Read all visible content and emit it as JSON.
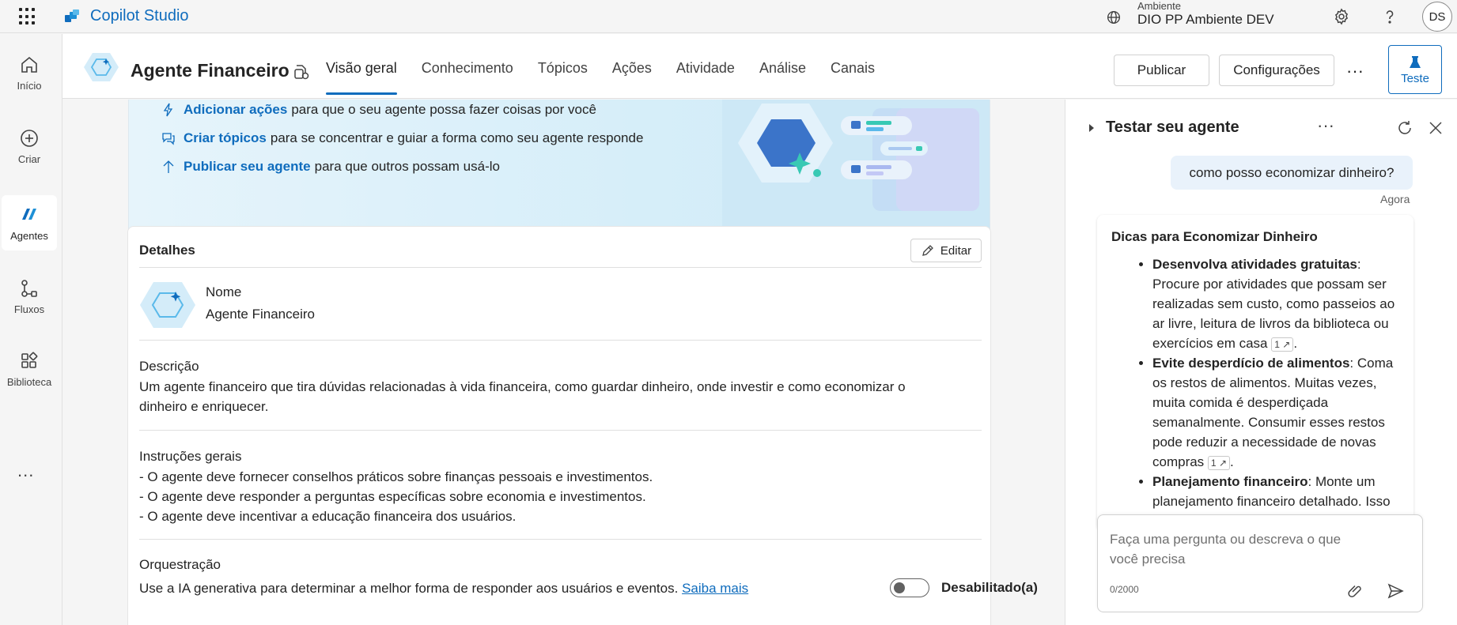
{
  "app": {
    "name": "Copilot Studio",
    "environment_label": "Ambiente",
    "environment_name": "DIO PP Ambiente DEV",
    "avatar_initials": "DS"
  },
  "leftnav": {
    "items": [
      {
        "label": "Início",
        "icon": "home-icon"
      },
      {
        "label": "Criar",
        "icon": "plus-circle-icon"
      },
      {
        "label": "Agentes",
        "icon": "agents-icon",
        "active": true
      },
      {
        "label": "Fluxos",
        "icon": "flows-icon"
      },
      {
        "label": "Biblioteca",
        "icon": "library-icon"
      }
    ],
    "more": "..."
  },
  "header": {
    "agent_name": "Agente Financeiro",
    "tabs": [
      "Visão geral",
      "Conhecimento",
      "Tópicos",
      "Ações",
      "Atividade",
      "Análise",
      "Canais"
    ],
    "active_tab": "Visão geral",
    "publish": "Publicar",
    "settings": "Configurações",
    "more": "···",
    "test": "Teste"
  },
  "banner": {
    "rows": [
      {
        "link": "Adicionar ações",
        "text": "para que o seu agente possa fazer coisas por você",
        "icon": "lightning-icon"
      },
      {
        "link": "Criar tópicos",
        "text": "para se concentrar e guiar a forma como seu agente responde",
        "icon": "chat-bubbles-icon"
      },
      {
        "link": "Publicar seu agente",
        "text": "para que outros possam usá-lo",
        "icon": "arrow-up-icon"
      }
    ]
  },
  "details": {
    "title": "Detalhes",
    "edit": "Editar",
    "name_label": "Nome",
    "name_value": "Agente Financeiro",
    "description_label": "Descrição",
    "description_line1": "Um agente financeiro que tira dúvidas relacionadas à vida financeira, como guardar dinheiro, onde investir e como economizar o",
    "description_line2": "dinheiro e enriquecer.",
    "instructions_label": "Instruções gerais",
    "instructions": [
      "- O agente deve fornecer conselhos práticos sobre finanças pessoais e investimentos.",
      "- O agente deve responder a perguntas específicas sobre economia e investimentos.",
      "- O agente deve incentivar a educação financeira dos usuários."
    ],
    "orchestration_label": "Orquestração",
    "orchestration_text": "Use a IA generativa para determinar a melhor forma de responder aos usuários e eventos.",
    "orchestration_link": "Saiba mais",
    "orchestration_toggle": "Desabilitado(a)"
  },
  "test_panel": {
    "title": "Testar seu agente",
    "user_message": "como posso economizar dinheiro?",
    "user_time": "Agora",
    "bot_title": "Dicas para Economizar Dinheiro",
    "tips": [
      {
        "bold": "Desenvolva atividades gratuitas",
        "text": ": Procure por atividades que possam ser realizadas sem custo, como passeios ao ar livre, leitura de livros da biblioteca ou exercícios em casa",
        "cite": "1"
      },
      {
        "bold": "Evite desperdício de alimentos",
        "text": ": Coma os restos de alimentos. Muitas vezes, muita comida é desperdiçada semanalmente. Consumir esses restos pode reduzir a necessidade de novas compras",
        "cite": "1"
      },
      {
        "bold": "Planejamento financeiro",
        "text": ": Monte um planejamento financeiro detalhado. Isso",
        "cite": ""
      }
    ],
    "input_placeholder": "Faça uma pergunta ou descreva o que você precisa",
    "counter": "0/2000"
  },
  "colors": {
    "accent": "#0f6cbd",
    "user_bubble": "#e9f2fb",
    "banner_bg": "#d6eef9"
  }
}
